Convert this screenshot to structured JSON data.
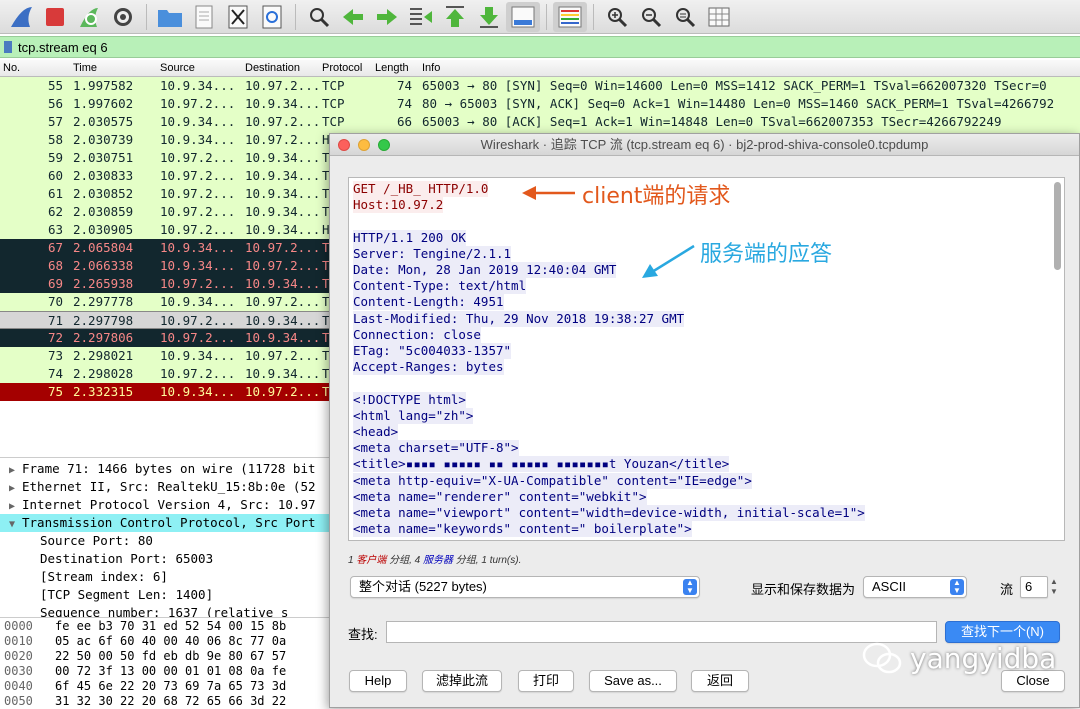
{
  "toolbar": {
    "icons": [
      "shark-fin-icon",
      "stop-icon",
      "restart-icon",
      "gear-icon",
      "folder-icon",
      "file-icon",
      "close-file-icon",
      "reload-icon",
      "search-icon",
      "back-arrow-icon",
      "forward-arrow-icon",
      "go-to-packet-icon",
      "first-packet-icon",
      "last-packet-icon",
      "autoscroll-icon",
      "colorize-icon",
      "zoom-in-icon",
      "zoom-out-icon",
      "normal-size-icon",
      "resize-columns-icon"
    ]
  },
  "filter": {
    "text": "tcp.stream eq 6"
  },
  "columns": {
    "no": "No.",
    "time": "Time",
    "source": "Source",
    "destination": "Destination",
    "protocol": "Protocol",
    "length": "Length",
    "info": "Info"
  },
  "packets": [
    {
      "no": "55",
      "time": "1.997582",
      "src": "10.9.34...",
      "dst": "10.97.2...",
      "proto": "TCP",
      "len": "74",
      "info": "65003 → 80 [SYN] Seq=0 Win=14600 Len=0 MSS=1412 SACK_PERM=1 TSval=662007320 TSecr=0",
      "style": "green"
    },
    {
      "no": "56",
      "time": "1.997602",
      "src": "10.97.2...",
      "dst": "10.9.34...",
      "proto": "TCP",
      "len": "74",
      "info": "80 → 65003 [SYN, ACK] Seq=0 Ack=1 Win=14480 Len=0 MSS=1460 SACK_PERM=1 TSval=4266792",
      "style": "green"
    },
    {
      "no": "57",
      "time": "2.030575",
      "src": "10.9.34...",
      "dst": "10.97.2...",
      "proto": "TCP",
      "len": "66",
      "info": "65003 → 80 [ACK] Seq=1 Ack=1 Win=14848 Len=0 TSval=662007353 TSecr=4266792249",
      "style": "green"
    },
    {
      "no": "58",
      "time": "2.030739",
      "src": "10.9.34...",
      "dst": "10.97.2...",
      "proto": "H",
      "len": "",
      "info": "",
      "style": "green"
    },
    {
      "no": "59",
      "time": "2.030751",
      "src": "10.97.2...",
      "dst": "10.9.34...",
      "proto": "T",
      "len": "",
      "info": "",
      "style": "green"
    },
    {
      "no": "60",
      "time": "2.030833",
      "src": "10.97.2...",
      "dst": "10.9.34...",
      "proto": "T",
      "len": "",
      "info": "",
      "style": "green"
    },
    {
      "no": "61",
      "time": "2.030852",
      "src": "10.97.2...",
      "dst": "10.9.34...",
      "proto": "T",
      "len": "",
      "info": "",
      "style": "green"
    },
    {
      "no": "62",
      "time": "2.030859",
      "src": "10.97.2...",
      "dst": "10.9.34...",
      "proto": "T",
      "len": "",
      "info": "",
      "style": "green"
    },
    {
      "no": "63",
      "time": "2.030905",
      "src": "10.97.2...",
      "dst": "10.9.34...",
      "proto": "H",
      "len": "",
      "info": "",
      "style": "green"
    },
    {
      "no": "67",
      "time": "2.065804",
      "src": "10.9.34...",
      "dst": "10.97.2...",
      "proto": "T",
      "len": "",
      "info": "",
      "style": "dark"
    },
    {
      "no": "68",
      "time": "2.066338",
      "src": "10.9.34...",
      "dst": "10.97.2...",
      "proto": "T",
      "len": "",
      "info": "",
      "style": "dark"
    },
    {
      "no": "69",
      "time": "2.265938",
      "src": "10.97.2...",
      "dst": "10.9.34...",
      "proto": "T",
      "len": "",
      "info": "",
      "style": "dark"
    },
    {
      "no": "70",
      "time": "2.297778",
      "src": "10.9.34...",
      "dst": "10.97.2...",
      "proto": "T",
      "len": "",
      "info": "",
      "style": "green"
    },
    {
      "no": "71",
      "time": "2.297798",
      "src": "10.97.2...",
      "dst": "10.9.34...",
      "proto": "T",
      "len": "",
      "info": "",
      "style": "selected"
    },
    {
      "no": "72",
      "time": "2.297806",
      "src": "10.97.2...",
      "dst": "10.9.34...",
      "proto": "T",
      "len": "",
      "info": "",
      "style": "dark"
    },
    {
      "no": "73",
      "time": "2.298021",
      "src": "10.9.34...",
      "dst": "10.97.2...",
      "proto": "T",
      "len": "",
      "info": "",
      "style": "green"
    },
    {
      "no": "74",
      "time": "2.298028",
      "src": "10.97.2...",
      "dst": "10.9.34...",
      "proto": "T",
      "len": "",
      "info": "",
      "style": "green"
    },
    {
      "no": "75",
      "time": "2.332315",
      "src": "10.9.34...",
      "dst": "10.97.2...",
      "proto": "T",
      "len": "",
      "info": "",
      "style": "red"
    }
  ],
  "details": [
    {
      "text": "Frame 71: 1466 bytes on wire (11728 bit",
      "arrow": "▶",
      "indent": 0,
      "hl": false
    },
    {
      "text": "Ethernet II, Src: RealtekU_15:8b:0e (52",
      "arrow": "▶",
      "indent": 0,
      "hl": false
    },
    {
      "text": "Internet Protocol Version 4, Src: 10.97",
      "arrow": "▶",
      "indent": 0,
      "hl": false
    },
    {
      "text": "Transmission Control Protocol, Src Port",
      "arrow": "▼",
      "indent": 0,
      "hl": true
    },
    {
      "text": "Source Port: 80",
      "arrow": "",
      "indent": 1,
      "hl": false
    },
    {
      "text": "Destination Port: 65003",
      "arrow": "",
      "indent": 1,
      "hl": false
    },
    {
      "text": "[Stream index: 6]",
      "arrow": "",
      "indent": 1,
      "hl": false
    },
    {
      "text": "[TCP Segment Len: 1400]",
      "arrow": "",
      "indent": 1,
      "hl": false
    },
    {
      "text": "Sequence number: 1637    (relative s",
      "arrow": "",
      "indent": 1,
      "hl": false
    }
  ],
  "hex": [
    {
      "off": "0000",
      "bytes": "fe ee b3 70 31 ed 52 54  00 15 8b"
    },
    {
      "off": "0010",
      "bytes": "05 ac 6f 60 40 00 40 06  8c 77 0a"
    },
    {
      "off": "0020",
      "bytes": "22 50 00 50 fd eb db 9e  80 67 57"
    },
    {
      "off": "0030",
      "bytes": "00 72 3f 13 00 00 01 01  08 0a fe"
    },
    {
      "off": "0040",
      "bytes": "6f 45 6e 22 20 73 69 7a  65 73 3d"
    },
    {
      "off": "0050",
      "bytes": "31 32 30 22 20 68 72 65  66 3d 22"
    }
  ],
  "dialog": {
    "title": "Wireshark · 追踪 TCP 流 (tcp.stream eq 6) · bj2-prod-shiva-console0.tcpdump",
    "stream_lines": [
      {
        "text": "GET /_HB_ HTTP/1.0",
        "type": "client"
      },
      {
        "text": "Host:10.97.2",
        "type": "client"
      },
      {
        "text": "",
        "type": "blank"
      },
      {
        "text": "HTTP/1.1 200 OK",
        "type": "server"
      },
      {
        "text": "Server: Tengine/2.1.1",
        "type": "server"
      },
      {
        "text": "Date: Mon, 28 Jan 2019 12:40:04 GMT",
        "type": "server"
      },
      {
        "text": "Content-Type: text/html",
        "type": "server"
      },
      {
        "text": "Content-Length: 4951",
        "type": "server"
      },
      {
        "text": "Last-Modified: Thu, 29 Nov 2018 19:38:27 GMT",
        "type": "server"
      },
      {
        "text": "Connection: close",
        "type": "server"
      },
      {
        "text": "ETag: \"5c004033-1357\"",
        "type": "server"
      },
      {
        "text": "Accept-Ranges: bytes",
        "type": "server"
      },
      {
        "text": "",
        "type": "blank"
      },
      {
        "text": "<!DOCTYPE html>",
        "type": "server"
      },
      {
        "text": "<html lang=\"zh\">",
        "type": "server"
      },
      {
        "text": "<head>",
        "type": "server"
      },
      {
        "text": "  <meta charset=\"UTF-8\">",
        "type": "server"
      },
      {
        "text": "  <title>▪▪▪▪  ▪▪▪▪▪ ▪▪ ▪▪▪▪▪  ▪▪▪▪▪▪▪t Youzan</title>",
        "type": "server"
      },
      {
        "text": "  <meta http-equiv=\"X-UA-Compatible\" content=\"IE=edge\">",
        "type": "server"
      },
      {
        "text": "  <meta name=\"renderer\" content=\"webkit\">",
        "type": "server"
      },
      {
        "text": "  <meta name=\"viewport\" content=\"width=device-width, initial-scale=1\">",
        "type": "server"
      },
      {
        "text": "  <meta name=\"keywords\" content=\" boilerplate\">",
        "type": "server"
      }
    ],
    "summary": {
      "p1": "1 ",
      "client": "客户端",
      "p2": " 分组, 4 ",
      "server": "服务器",
      "p3": " 分组, 1 turn(s)."
    },
    "conversation_select": "整个对话 (5227 bytes)",
    "show_as_label": "显示和保存数据为",
    "show_as_value": "ASCII",
    "stream_label": "流",
    "stream_value": "6",
    "find_label": "查找:",
    "find_value": "",
    "find_next": "查找下一个(N)",
    "buttons": {
      "help": "Help",
      "filter_out": "滤掉此流",
      "print": "打印",
      "save_as": "Save as...",
      "back": "返回",
      "close": "Close"
    }
  },
  "annotations": {
    "client": "client端的请求",
    "server": "服务端的应答"
  },
  "watermark": "yangyidba"
}
